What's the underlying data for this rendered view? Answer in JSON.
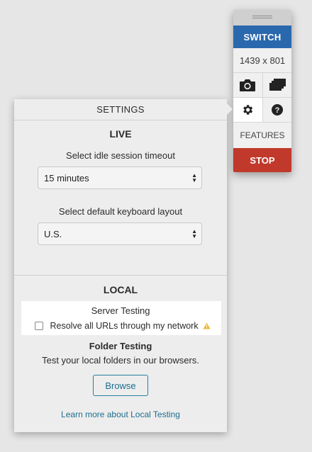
{
  "toolbar": {
    "switch_label": "SWITCH",
    "resolution": "1439 x 801",
    "features_label": "FEATURES",
    "stop_label": "STOP",
    "icons": {
      "camera": "camera-icon",
      "screens": "multiple-screens-icon",
      "settings": "gear-icon",
      "help": "help-icon"
    },
    "colors": {
      "switch": "#2a68ad",
      "stop": "#c0392b"
    }
  },
  "settings": {
    "title": "SETTINGS",
    "live": {
      "heading": "LIVE",
      "timeout_label": "Select idle session timeout",
      "timeout_value": "15 minutes",
      "keyboard_label": "Select default keyboard layout",
      "keyboard_value": "U.S."
    },
    "local": {
      "heading": "LOCAL",
      "server_testing_title": "Server Testing",
      "resolve_urls_label": "Resolve all URLs through my network",
      "resolve_urls_checked": false,
      "folder_testing_title": "Folder Testing",
      "folder_testing_desc": "Test your local folders in our browsers.",
      "browse_label": "Browse",
      "learn_more_link": "Learn more about Local Testing"
    }
  }
}
